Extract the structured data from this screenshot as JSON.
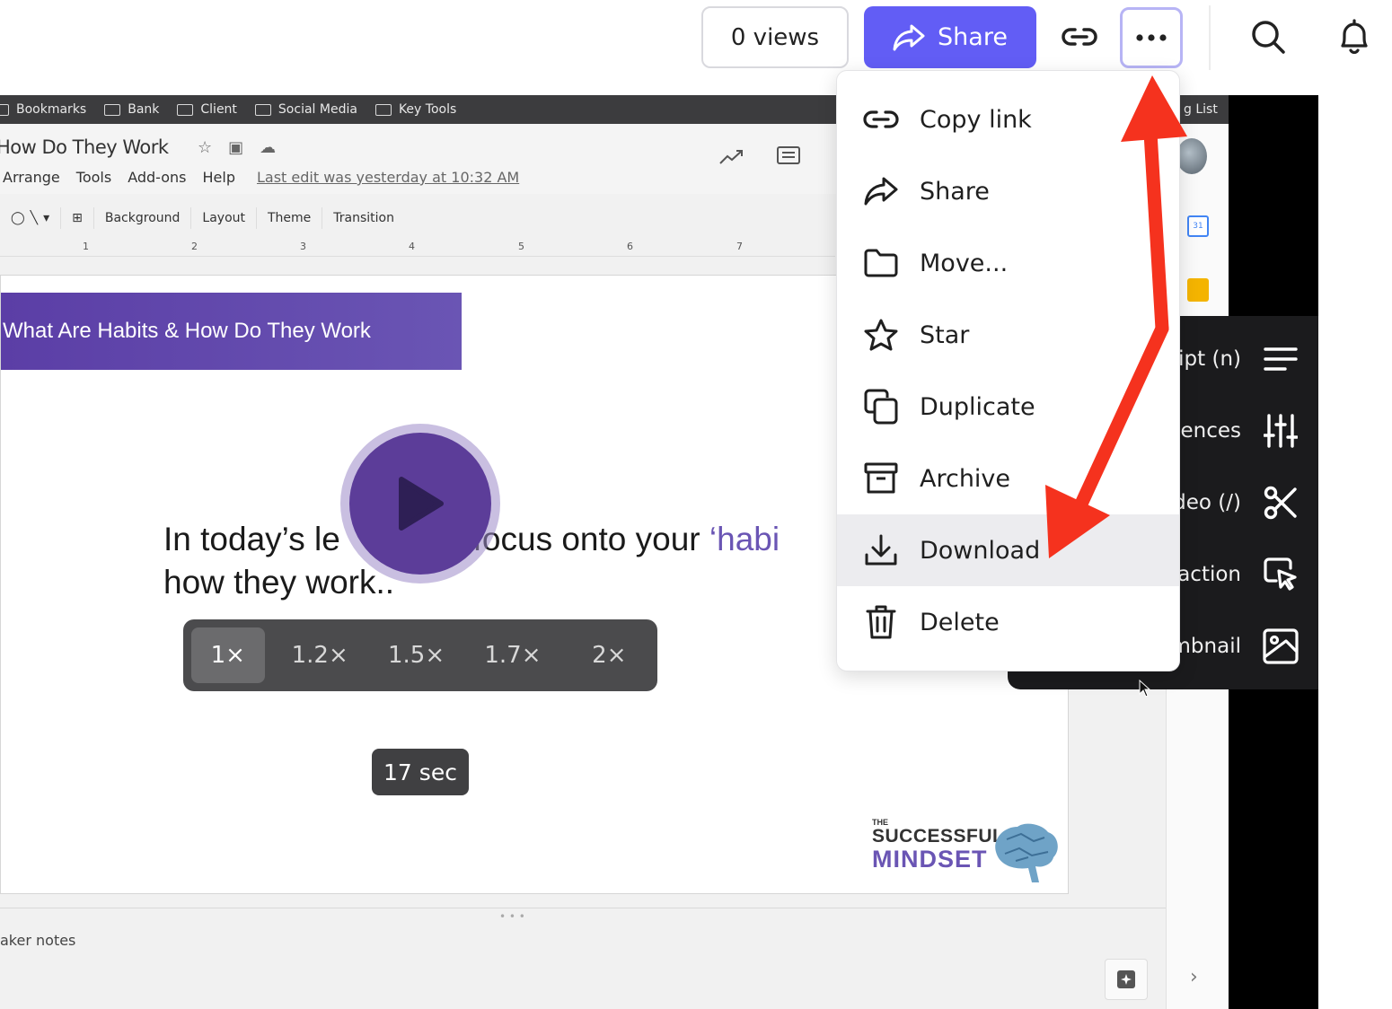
{
  "header": {
    "views_label": "0 views",
    "share_label": "Share",
    "icons": [
      "link-icon",
      "more-icon",
      "search-icon",
      "bell-icon"
    ]
  },
  "menu": {
    "items": [
      {
        "label": "Copy link",
        "icon": "link-icon"
      },
      {
        "label": "Share",
        "icon": "share-arrow-icon"
      },
      {
        "label": "Move...",
        "icon": "folder-icon"
      },
      {
        "label": "Star",
        "icon": "star-icon"
      },
      {
        "label": "Duplicate",
        "icon": "duplicate-icon"
      },
      {
        "label": "Archive",
        "icon": "archive-icon"
      },
      {
        "label": "Download",
        "icon": "download-icon",
        "highlighted": true
      },
      {
        "label": "Delete",
        "icon": "trash-icon"
      }
    ]
  },
  "browser": {
    "bookmarks": [
      "Bookmarks",
      "Bank",
      "Client",
      "Social Media",
      "Key Tools"
    ],
    "bookmarks_right": "g List"
  },
  "docs": {
    "title": "How Do They Work",
    "menus": [
      "Arrange",
      "Tools",
      "Add-ons",
      "Help"
    ],
    "last_edit": "Last edit was yesterday at 10:32 AM",
    "toolbar": [
      "Background",
      "Layout",
      "Theme",
      "Transition"
    ],
    "ruler": [
      "1",
      "2",
      "3",
      "4",
      "5",
      "6",
      "7"
    ],
    "speaker_notes": "aker notes"
  },
  "slide": {
    "banner": "What Are Habits & How Do They Work",
    "line1_a": "In today’s le",
    "line1_b": "e focus onto your ",
    "line1_accent": "‘habi",
    "line2": "how they work..",
    "brand_the": "THE",
    "brand_line1": "SUCCESSFUL",
    "brand_line2": "MINDSET"
  },
  "loom_panel": {
    "items": [
      {
        "label": "ipt (n)",
        "icon": "transcript-icon"
      },
      {
        "label": "ences",
        "icon": "preferences-icon"
      },
      {
        "label": "deo (/)",
        "icon": "scissors-icon"
      },
      {
        "label": "action",
        "icon": "call-to-action-icon"
      },
      {
        "label": "mbnail",
        "icon": "image-icon"
      }
    ]
  },
  "player": {
    "speeds": [
      "1×",
      "1.2×",
      "1.5×",
      "1.7×",
      "2×"
    ],
    "active_speed": "1×",
    "time_label": "17 sec"
  },
  "colors": {
    "accent": "#625df5",
    "play": "#5c3d99",
    "annotation": "#f5321e"
  }
}
